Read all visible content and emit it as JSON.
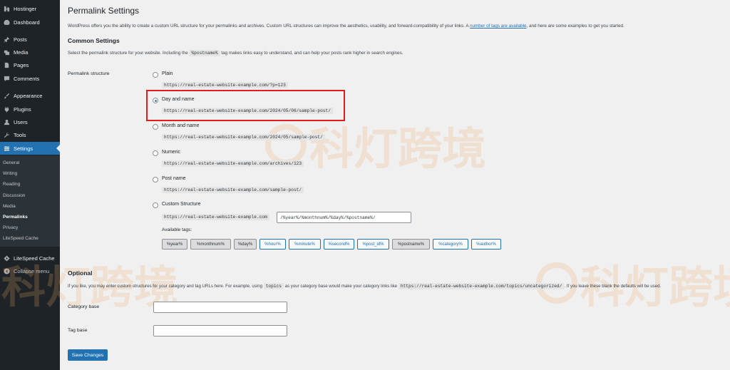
{
  "sidebar": {
    "items": [
      {
        "label": "Hostinger",
        "icon": "hostinger-icon"
      },
      {
        "label": "Dashboard",
        "icon": "dashboard-icon"
      },
      {
        "label": "Posts",
        "icon": "pin-icon"
      },
      {
        "label": "Media",
        "icon": "media-icon"
      },
      {
        "label": "Pages",
        "icon": "page-icon"
      },
      {
        "label": "Comments",
        "icon": "comment-icon"
      },
      {
        "label": "Appearance",
        "icon": "brush-icon"
      },
      {
        "label": "Plugins",
        "icon": "plug-icon"
      },
      {
        "label": "Users",
        "icon": "user-icon"
      },
      {
        "label": "Tools",
        "icon": "wrench-icon"
      },
      {
        "label": "Settings",
        "icon": "settings-icon"
      }
    ],
    "submenu": [
      "General",
      "Writing",
      "Reading",
      "Discussion",
      "Media",
      "Permalinks",
      "Privacy",
      "LiteSpeed Cache"
    ],
    "litespeed": "LiteSpeed Cache",
    "collapse": "Collapse menu"
  },
  "page": {
    "title": "Permalink Settings",
    "intro_before": "WordPress offers you the ability to create a custom URL structure for your permalinks and archives. Custom URL structures can improve the aesthetics, usability, and forward-compatibility of your links. A ",
    "intro_link": "number of tags are available",
    "intro_after": ", and here are some examples to get you started."
  },
  "common": {
    "heading": "Common Settings",
    "desc_before": "Select the permalink structure for your website. Including the ",
    "desc_code": "%postname%",
    "desc_after": " tag makes links easy to understand, and can help your posts rank higher in search engines.",
    "field_label": "Permalink structure",
    "options": [
      {
        "label": "Plain",
        "example": "https://real-estate-website-example.com/?p=123"
      },
      {
        "label": "Day and name",
        "example": "https://real-estate-website-example.com/2024/05/06/sample-post/"
      },
      {
        "label": "Month and name",
        "example": "https://real-estate-website-example.com/2024/05/sample-post/"
      },
      {
        "label": "Numeric",
        "example": "https://real-estate-website-example.com/archives/123"
      },
      {
        "label": "Post name",
        "example": "https://real-estate-website-example.com/sample-post/"
      },
      {
        "label": "Custom Structure",
        "example": "https://real-estate-website-example.com"
      }
    ],
    "selected_option": "Day and name",
    "custom_value": "/%year%/%monthnum%/%day%/%postname%/",
    "available_tags_label": "Available tags:",
    "tags": [
      "%year%",
      "%monthnum%",
      "%day%",
      "%hour%",
      "%minute%",
      "%second%",
      "%post_id%",
      "%postname%",
      "%category%",
      "%author%"
    ]
  },
  "optional": {
    "heading": "Optional",
    "desc_before": "If you like, you may enter custom structures for your category and tag URLs here. For example, using ",
    "desc_code1": "topics",
    "desc_middle": " as your category base would make your category links like ",
    "desc_code2": "https://real-estate-website-example.com/topics/uncategorized/",
    "desc_after": ". If you leave these blank the defaults will be used.",
    "category_label": "Category base",
    "category_value": "",
    "tag_label": "Tag base",
    "tag_value": ""
  },
  "save_label": "Save Changes",
  "watermark": "科灯跨境",
  "colors": {
    "admin_bar": "#1d2327",
    "accent": "#2271b1",
    "highlight": "#e31c1c"
  }
}
